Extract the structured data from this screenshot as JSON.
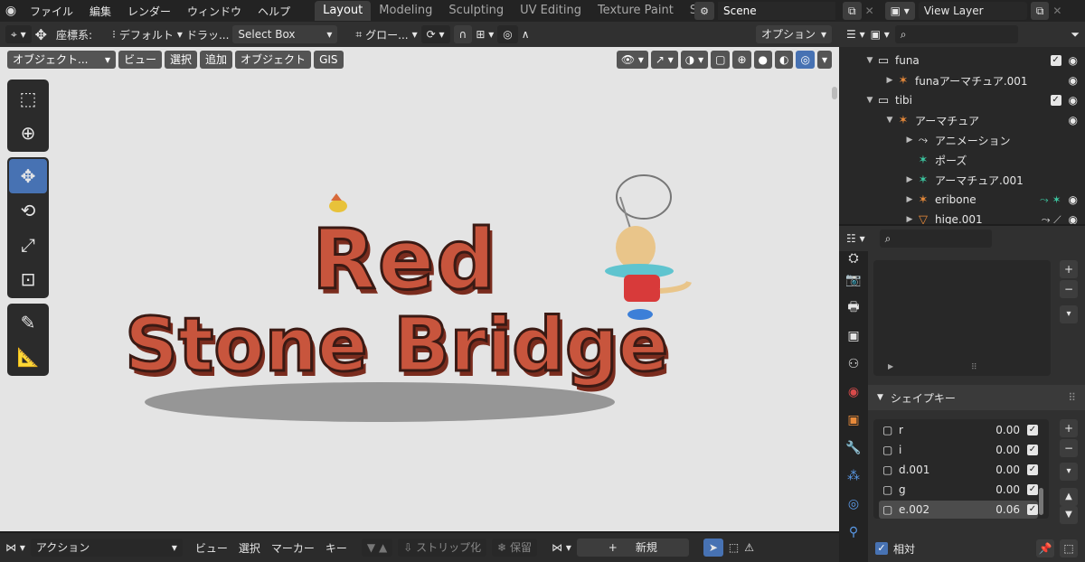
{
  "topbar": {
    "menus": [
      "ファイル",
      "編集",
      "レンダー",
      "ウィンドウ",
      "ヘルプ"
    ],
    "workspace_tabs": [
      "Layout",
      "Modeling",
      "Sculpting",
      "UV Editing",
      "Texture Paint",
      "Sh"
    ],
    "scene": "Scene",
    "view_layer": "View Layer"
  },
  "tool_header": {
    "orientation_label": "座標系:",
    "orientation_value": "デフォルト",
    "drag_label": "ドラッ...",
    "drag_value": "Select Box",
    "transform_orientation": "グロー...",
    "options": "オプション"
  },
  "viewport_header": {
    "mode": "オブジェクト...",
    "menus": [
      "ビュー",
      "選択",
      "追加",
      "オブジェクト",
      "GIS"
    ]
  },
  "scene_text": {
    "line1": "Red",
    "line2": "Stone Bridge"
  },
  "timeline": {
    "editor": "アクション",
    "menus": [
      "ビュー",
      "選択",
      "マーカー",
      "キー"
    ],
    "strip_label": "ストリップ化",
    "stash_label": "保留",
    "new_label": "新規"
  },
  "outliner": {
    "rows": [
      {
        "label": "funa",
        "level": 1,
        "icon": "collection-icon",
        "check": true
      },
      {
        "label": "funaアーマチュア.001",
        "level": 2,
        "icon": "armature-icon"
      },
      {
        "label": "tibi",
        "level": 1,
        "icon": "collection-icon",
        "check": true
      },
      {
        "label": "アーマチュア",
        "level": 2,
        "icon": "armature-icon"
      },
      {
        "label": "アニメーション",
        "level": 3,
        "icon": "animation-icon"
      },
      {
        "label": "ポーズ",
        "level": 3,
        "icon": "pose-icon"
      },
      {
        "label": "アーマチュア.001",
        "level": 3,
        "icon": "armature-data-icon"
      },
      {
        "label": "eribone",
        "level": 3,
        "icon": "armature-icon"
      },
      {
        "label": "hige.001",
        "level": 3,
        "icon": "mesh-icon"
      }
    ]
  },
  "properties": {
    "shape_keys_title": "シェイプキー",
    "shape_keys": [
      {
        "name": "r",
        "value": "0.00"
      },
      {
        "name": "i",
        "value": "0.00"
      },
      {
        "name": "d.001",
        "value": "0.00"
      },
      {
        "name": "g",
        "value": "0.00"
      },
      {
        "name": "e.002",
        "value": "0.06"
      }
    ],
    "relative_label": "相対"
  },
  "colors": {
    "accent": "#4772b3",
    "text_3d": "#c8553d",
    "text_outline": "#3a1a14"
  }
}
